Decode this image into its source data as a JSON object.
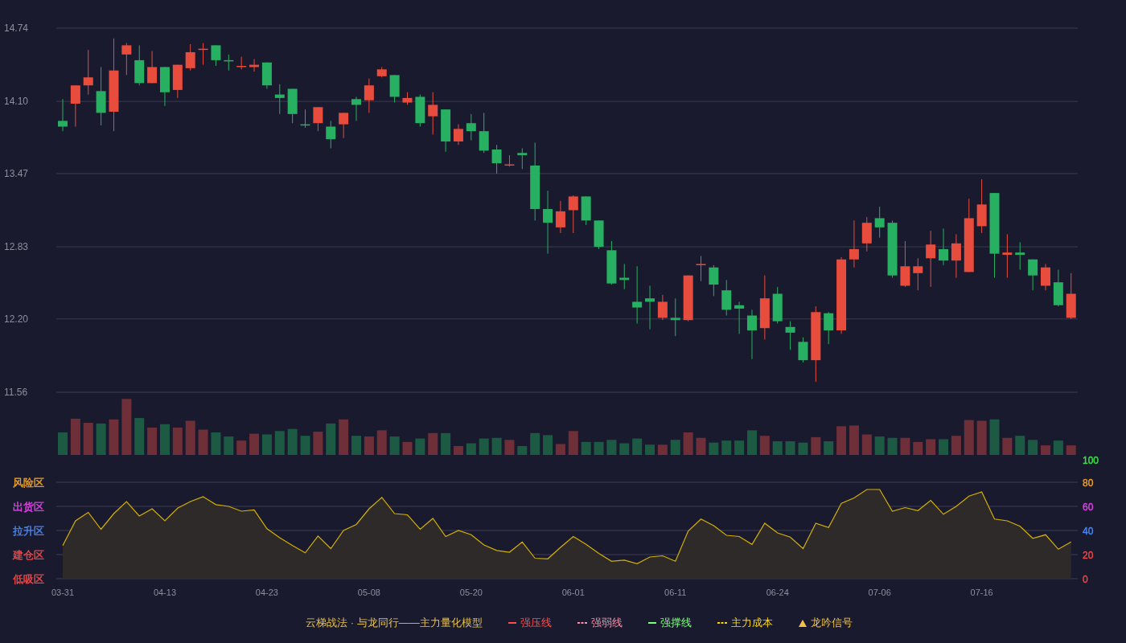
{
  "price_chart": {
    "chart_data": {
      "type": "candlestick",
      "grid": true,
      "ylim": [
        11.56,
        14.74
      ],
      "yticks": [
        {
          "value": 14.74,
          "label": "14.74"
        },
        {
          "value": 14.1,
          "label": "14.10"
        },
        {
          "value": 13.47,
          "label": "13.47"
        },
        {
          "value": 12.83,
          "label": "12.83"
        },
        {
          "value": 12.2,
          "label": "12.20"
        },
        {
          "value": 11.56,
          "label": "11.56"
        }
      ],
      "ohlc": [
        [
          13.93,
          14.12,
          13.84,
          13.88
        ],
        [
          14.08,
          14.24,
          13.88,
          14.24
        ],
        [
          14.24,
          14.55,
          14.16,
          14.31
        ],
        [
          14.19,
          14.4,
          13.89,
          14.0
        ],
        [
          14.01,
          14.65,
          13.84,
          14.37
        ],
        [
          14.51,
          14.61,
          14.33,
          14.59
        ],
        [
          14.46,
          14.59,
          14.24,
          14.26
        ],
        [
          14.26,
          14.54,
          14.26,
          14.4
        ],
        [
          14.4,
          14.4,
          14.06,
          14.18
        ],
        [
          14.2,
          14.42,
          14.13,
          14.42
        ],
        [
          14.39,
          14.6,
          14.37,
          14.53
        ],
        [
          14.55,
          14.61,
          14.42,
          14.56
        ],
        [
          14.59,
          14.59,
          14.41,
          14.46
        ],
        [
          14.46,
          14.51,
          14.37,
          14.45
        ],
        [
          14.4,
          14.49,
          14.38,
          14.41
        ],
        [
          14.4,
          14.47,
          14.36,
          14.42
        ],
        [
          14.44,
          14.44,
          14.21,
          14.24
        ],
        [
          14.16,
          14.25,
          13.99,
          14.13
        ],
        [
          14.21,
          14.21,
          13.91,
          13.99
        ],
        [
          13.9,
          14.03,
          13.87,
          13.89
        ],
        [
          13.91,
          14.05,
          13.84,
          14.05
        ],
        [
          13.88,
          13.93,
          13.69,
          13.77
        ],
        [
          13.9,
          14.0,
          13.78,
          14.0
        ],
        [
          14.12,
          14.14,
          13.93,
          14.07
        ],
        [
          14.11,
          14.3,
          14.0,
          14.24
        ],
        [
          14.32,
          14.4,
          14.31,
          14.38
        ],
        [
          14.33,
          14.33,
          14.09,
          14.14
        ],
        [
          14.09,
          14.18,
          14.07,
          14.13
        ],
        [
          14.14,
          14.16,
          13.88,
          13.91
        ],
        [
          13.97,
          14.18,
          13.81,
          14.07
        ],
        [
          14.03,
          14.03,
          13.66,
          13.75
        ],
        [
          13.75,
          13.9,
          13.72,
          13.86
        ],
        [
          13.91,
          13.99,
          13.76,
          13.84
        ],
        [
          13.84,
          14.0,
          13.65,
          13.67
        ],
        [
          13.68,
          13.72,
          13.47,
          13.56
        ],
        [
          13.54,
          13.63,
          13.53,
          13.55
        ],
        [
          13.65,
          13.69,
          13.51,
          13.63
        ],
        [
          13.54,
          13.74,
          13.06,
          13.16
        ],
        [
          13.16,
          13.32,
          12.77,
          13.04
        ],
        [
          13.0,
          13.23,
          12.95,
          13.14
        ],
        [
          13.15,
          13.28,
          12.95,
          13.27
        ],
        [
          13.27,
          13.27,
          13.02,
          13.06
        ],
        [
          13.06,
          13.06,
          12.81,
          12.83
        ],
        [
          12.8,
          12.88,
          12.5,
          12.51
        ],
        [
          12.56,
          12.68,
          12.46,
          12.54
        ],
        [
          12.35,
          12.66,
          12.16,
          12.3
        ],
        [
          12.38,
          12.49,
          12.11,
          12.35
        ],
        [
          12.21,
          12.41,
          12.19,
          12.35
        ],
        [
          12.21,
          12.38,
          12.05,
          12.19
        ],
        [
          12.19,
          12.58,
          12.18,
          12.58
        ],
        [
          12.67,
          12.75,
          12.53,
          12.68
        ],
        [
          12.65,
          12.67,
          12.4,
          12.5
        ],
        [
          12.45,
          12.54,
          12.23,
          12.28
        ],
        [
          12.32,
          12.35,
          12.07,
          12.29
        ],
        [
          12.23,
          12.28,
          11.85,
          12.1
        ],
        [
          12.12,
          12.58,
          12.02,
          12.38
        ],
        [
          12.42,
          12.48,
          12.16,
          12.18
        ],
        [
          12.13,
          12.18,
          11.93,
          12.08
        ],
        [
          12.0,
          12.04,
          11.82,
          11.84
        ],
        [
          11.84,
          12.31,
          11.65,
          12.26
        ],
        [
          12.25,
          12.26,
          11.98,
          12.1
        ],
        [
          12.1,
          12.74,
          12.07,
          12.72
        ],
        [
          12.72,
          13.06,
          12.65,
          12.81
        ],
        [
          12.86,
          13.09,
          12.79,
          13.04
        ],
        [
          13.08,
          13.18,
          12.91,
          13.0
        ],
        [
          13.04,
          13.06,
          12.56,
          12.58
        ],
        [
          12.49,
          12.88,
          12.48,
          12.66
        ],
        [
          12.6,
          12.73,
          12.45,
          12.66
        ],
        [
          12.73,
          12.97,
          12.48,
          12.85
        ],
        [
          12.81,
          12.99,
          12.67,
          12.71
        ],
        [
          12.71,
          12.94,
          12.56,
          12.86
        ],
        [
          12.61,
          13.25,
          12.61,
          13.08
        ],
        [
          13.01,
          13.42,
          12.95,
          13.2
        ],
        [
          13.3,
          13.3,
          12.56,
          12.77
        ],
        [
          12.76,
          12.94,
          12.56,
          12.78
        ],
        [
          12.78,
          12.87,
          12.63,
          12.76
        ],
        [
          12.72,
          12.72,
          12.45,
          12.58
        ],
        [
          12.49,
          12.68,
          12.45,
          12.65
        ],
        [
          12.52,
          12.63,
          12.31,
          12.32
        ],
        [
          12.21,
          12.6,
          12.2,
          12.42
        ]
      ]
    }
  },
  "indicator": {
    "zones": [
      {
        "label": "风险区",
        "color": "#f0a020"
      },
      {
        "label": "出货区",
        "color": "#e040e8"
      },
      {
        "label": "拉升区",
        "color": "#4a86f0"
      },
      {
        "label": "建仓区",
        "color": "#f04848"
      },
      {
        "label": "低吸区",
        "color": "#f04848"
      }
    ],
    "tick_colors": [
      {
        "color": "#3ee04a"
      },
      {
        "color": "#f0a020"
      },
      {
        "color": "#e040e8"
      },
      {
        "color": "#4a86f0"
      },
      {
        "color": "#f04848"
      },
      {
        "color": "#f04848"
      }
    ],
    "x_labels": [
      "03-31",
      "04-13",
      "04-23",
      "05-08",
      "05-20",
      "06-01",
      "06-11",
      "06-24",
      "07-06",
      "07-16"
    ],
    "chart_data": {
      "type": "area",
      "grid": true,
      "ylim": [
        0,
        100
      ],
      "yticks": [
        {
          "value": 100,
          "label": "100"
        },
        {
          "value": 80,
          "label": "80"
        },
        {
          "value": 60,
          "label": "60"
        },
        {
          "value": 40,
          "label": "40"
        },
        {
          "value": 20,
          "label": "20"
        },
        {
          "value": 0,
          "label": "0"
        }
      ],
      "series": [
        {
          "color": "#d4b000",
          "values": [
            27.5,
            48,
            55,
            41,
            54,
            64,
            52,
            58,
            48,
            58.5,
            64,
            68,
            61.5,
            60,
            56,
            57,
            41.5,
            34,
            27.5,
            21.5,
            35.5,
            25,
            40,
            45,
            58,
            67.5,
            54,
            53,
            41,
            50,
            35,
            40,
            36.5,
            28,
            23.5,
            22,
            30.5,
            17,
            16.5,
            26,
            35,
            28.5,
            21,
            14.5,
            15.5,
            12.5,
            18,
            19,
            14.5,
            39.5,
            49.5,
            44,
            36,
            35,
            28.5,
            46,
            38,
            34.5,
            25,
            46,
            42.5,
            62.5,
            67,
            74,
            74,
            56,
            59,
            56.5,
            65,
            53.5,
            60,
            68.5,
            72,
            49.5,
            48,
            43.5,
            33.5,
            36.5,
            24.5,
            30.5
          ]
        }
      ]
    }
  },
  "legend": {
    "title": "云梯战法 · 与龙同行——主力量化模型",
    "items": [
      {
        "label": "强压线",
        "kind": "solid",
        "color": "#ff4d4d"
      },
      {
        "label": "强弱线",
        "kind": "dashed",
        "color": "#ff8fa3"
      },
      {
        "label": "强撑线",
        "kind": "solid",
        "color": "#7dff7d"
      },
      {
        "label": "主力成本",
        "kind": "dashed",
        "color": "#ffd700"
      },
      {
        "label": "龙吟信号",
        "kind": "triangle",
        "color": "#f0c14b"
      }
    ]
  }
}
